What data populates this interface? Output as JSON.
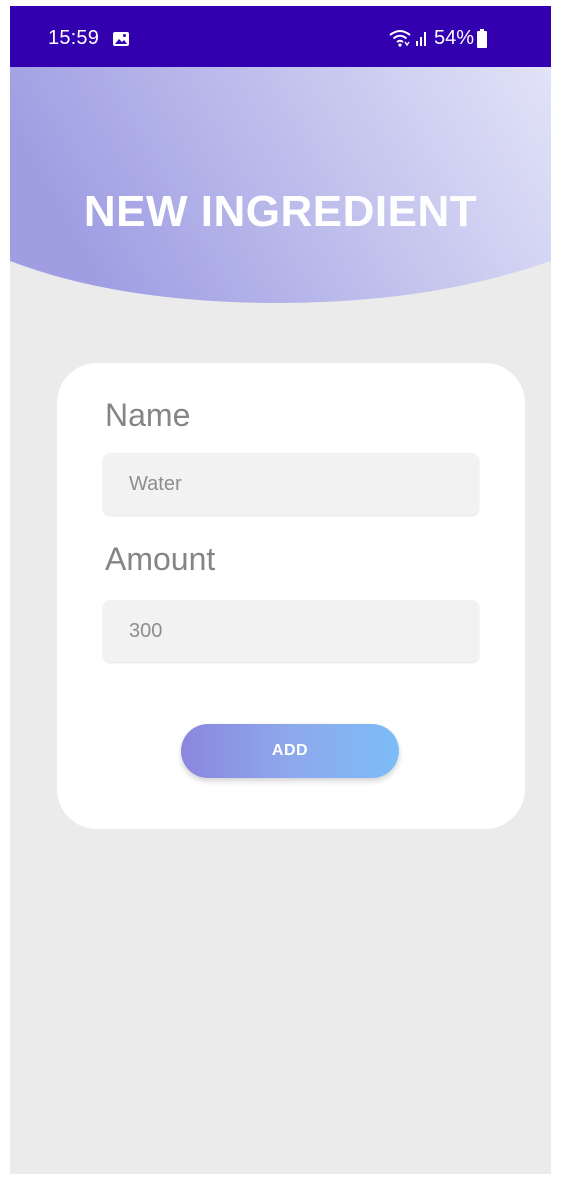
{
  "status_bar": {
    "time": "15:59",
    "battery": "54%",
    "background_color": "#3300b0",
    "icons": [
      "gallery-icon",
      "wifi-icon",
      "signal-icon",
      "battery-icon"
    ]
  },
  "header": {
    "title": "NEW INGREDIENT",
    "gradient_colors": [
      "#9f9ee3",
      "#e2e3f8"
    ]
  },
  "form": {
    "name_label": "Name",
    "name_value": "Water",
    "amount_label": "Amount",
    "amount_value": "300",
    "add_button_label": "ADD",
    "button_gradient": [
      "#8a86de",
      "#7cbcf7"
    ]
  }
}
